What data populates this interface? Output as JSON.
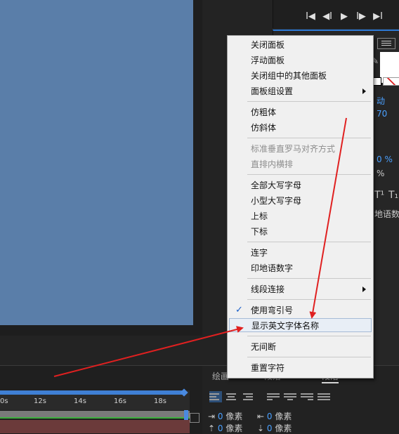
{
  "transport": {
    "buttons": [
      "I◀",
      "◀I",
      "▶",
      "I▶",
      "▶I"
    ]
  },
  "char_panel": {
    "frag_auto": "动",
    "frag_70": "70",
    "frag_pct1": "0 %",
    "frag_pct2": "%",
    "frag_super": "T¹",
    "frag_sub": "T₁",
    "frag_hindi": "地语数"
  },
  "timeline": {
    "ticks": [
      "0s",
      "12s",
      "14s",
      "16s",
      "18s"
    ]
  },
  "paragraph_panel": {
    "tabs": [
      "绘画",
      "段落",
      "段落"
    ],
    "indent_value": "0",
    "indent_unit": "像素",
    "rows": [
      {
        "value": "0",
        "unit": "像素"
      },
      {
        "value": "0",
        "unit": "像素"
      },
      {
        "value": "0",
        "unit": "像素"
      },
      {
        "value": "0",
        "unit": "像素"
      }
    ]
  },
  "menu": {
    "items": [
      {
        "label": "关闭面板"
      },
      {
        "label": "浮动面板"
      },
      {
        "label": "关闭组中的其他面板"
      },
      {
        "label": "面板组设置"
      },
      {
        "label": "仿粗体"
      },
      {
        "label": "仿斜体"
      },
      {
        "label": "标准垂直罗马对齐方式"
      },
      {
        "label": "直排内横排"
      },
      {
        "label": "全部大写字母"
      },
      {
        "label": "小型大写字母"
      },
      {
        "label": "上标"
      },
      {
        "label": "下标"
      },
      {
        "label": "连字"
      },
      {
        "label": "印地语数字"
      },
      {
        "label": "线段连接"
      },
      {
        "label": "使用弯引号"
      },
      {
        "label": "显示英文字体名称"
      },
      {
        "label": "无间断"
      },
      {
        "label": "重置字符"
      }
    ],
    "check_glyph": "✓"
  },
  "colors": {
    "viewer": "#5a7ea9",
    "accent": "#2d7ad6",
    "arrow": "#e02020"
  }
}
